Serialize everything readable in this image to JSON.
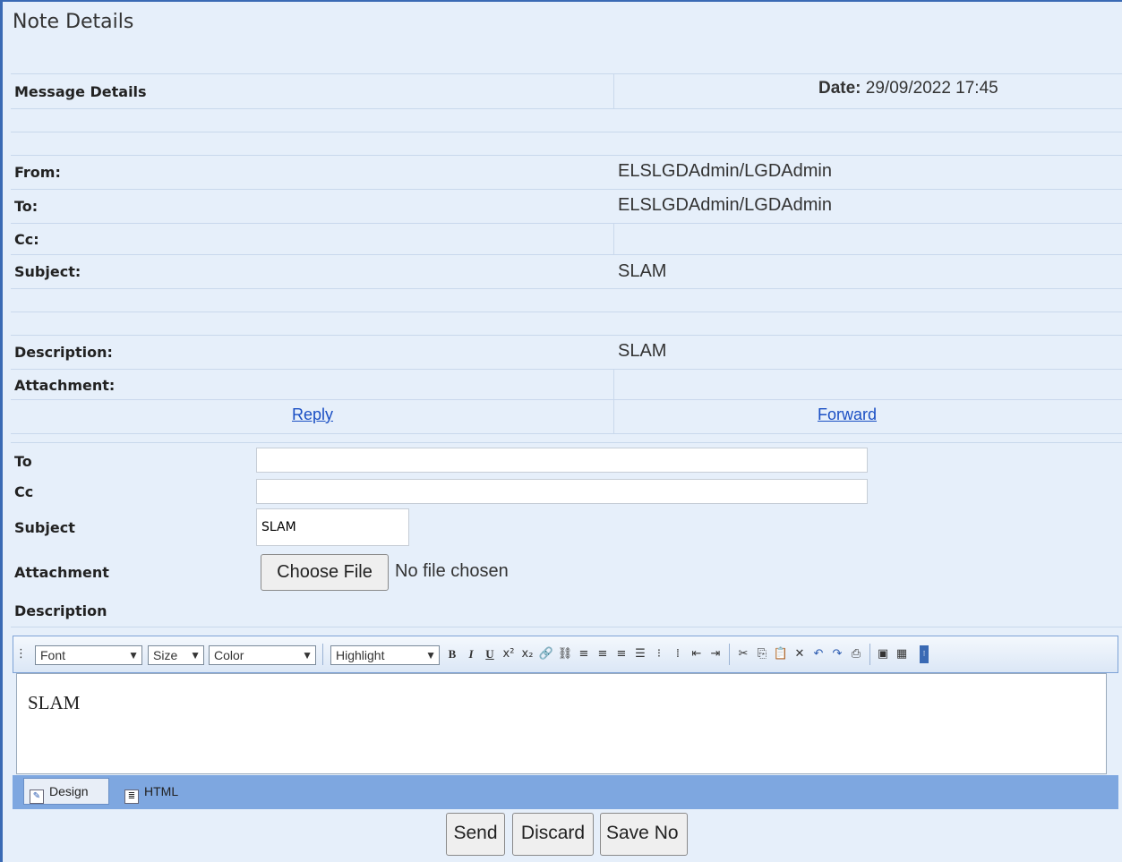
{
  "page": {
    "title": "Note Details"
  },
  "details": {
    "heading": "Message Details",
    "date_label": "Date:",
    "date_value": "29/09/2022 17:45",
    "from_label": "From:",
    "from_value": "ELSLGDAdmin/LGDAdmin",
    "to_label": "To:",
    "to_value": "ELSLGDAdmin/LGDAdmin",
    "cc_label": "Cc:",
    "cc_value": "",
    "subject_label": "Subject:",
    "subject_value": "SLAM",
    "description_label": "Description:",
    "description_value": "SLAM",
    "attachment_label": "Attachment:",
    "attachment_value": "",
    "reply_link": "Reply",
    "forward_link": "Forward"
  },
  "compose": {
    "to_label": "To",
    "to_value": "",
    "cc_label": "Cc",
    "cc_value": "",
    "subject_label": "Subject",
    "subject_value": "SLAM",
    "attachment_label": "Attachment",
    "choose_file": "Choose File",
    "no_file": "No file chosen",
    "description_label": "Description"
  },
  "editor": {
    "font_select": "Font",
    "size_select": "Size",
    "color_select": "Color",
    "highlight_select": "Highlight",
    "content": "SLAM",
    "design_tab": "Design",
    "html_tab": "HTML"
  },
  "actions": {
    "send": "Send",
    "discard": "Discard",
    "save": "Save No"
  }
}
